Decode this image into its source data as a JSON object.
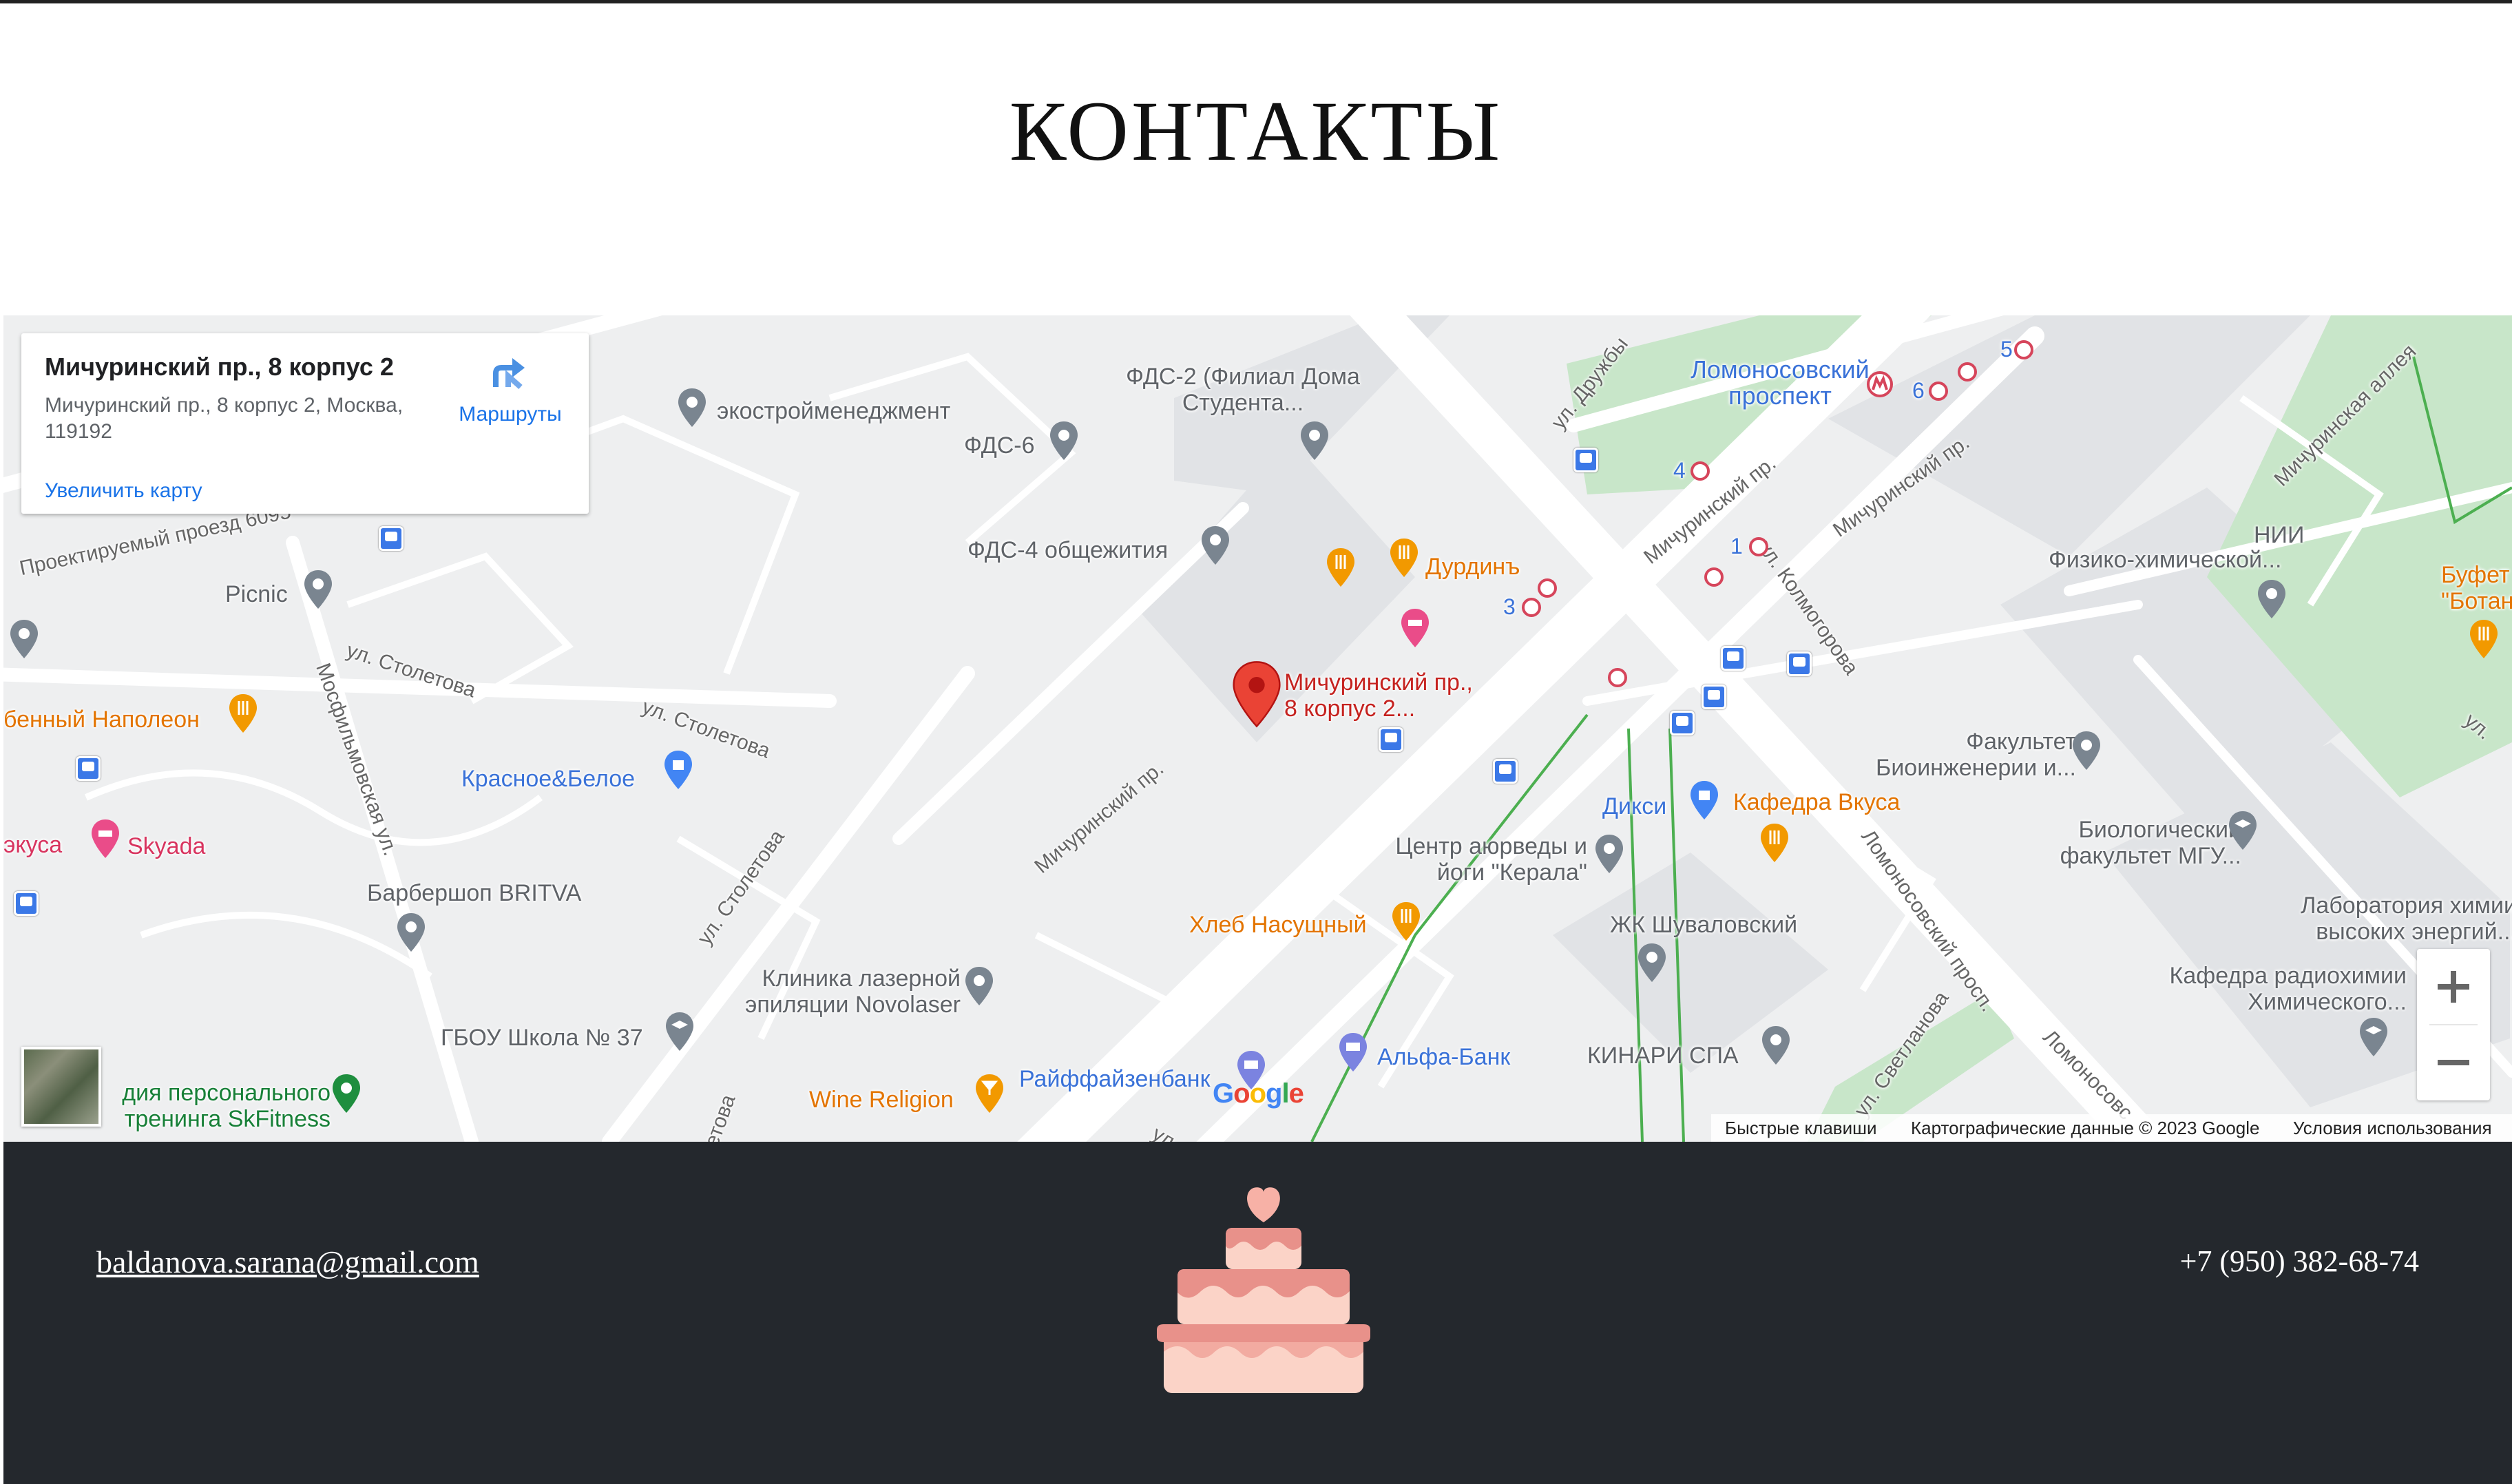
{
  "page": {
    "title": "КОНТАКТЫ"
  },
  "map": {
    "info_card": {
      "title": "Мичуринский пр., 8 корпус 2",
      "address": "Мичуринский пр., 8 корпус 2, Москва, 119192",
      "enlarge_label": "Увеличить карту",
      "directions_label": "Маршруты"
    },
    "labels": {
      "ecostroy": "экостройменеджмент",
      "fds2": "ФДС-2 (Филиал Дома Студента...",
      "fds6": "ФДС-6",
      "fds4": "ФДС-4 общежития",
      "durdin": "Дурдинъ",
      "marker": "Мичуринский пр., 8 корпус 2...",
      "lomonosov_metro": "Ломоносовский проспект",
      "fiziko": "Физико-химической...",
      "nii": "НИИ",
      "bufet": "Буфет \"Ботан",
      "fakultet_bio": "Факультет Биоинженерии и...",
      "biofak": "Биологический факультет МГУ...",
      "laboratory": "Лаборатория химии высоких энергий...",
      "kafedra_radio": "Кафедра радиохимии Химического...",
      "picnic": "Picnic",
      "napoleon": "бенный Наполеон",
      "krasnoe": "Красное&Белое",
      "skyada": "Skyada",
      "skyada_left": "экуса",
      "britva": "Барбершоп BRITVA",
      "dixi": "Дикси",
      "kafedra_vkusa": "Кафедра Вкуса",
      "ayurveda": "Центр аюрведы и йоги \"Керала\"",
      "hleb": "Хлеб Насущный",
      "zhk": "ЖК Шуваловский",
      "klinika": "Клиника лазерной эпиляции Novolaser",
      "gbou": "ГБОУ Школа № 37",
      "skfitness": "дия персонального тренинга SkFitness",
      "wine": "Wine Religion",
      "raiffeisen": "Райффайзенбанк",
      "alfa": "Альфа-Банк",
      "kinari": "КИНАРИ СПА",
      "road_proektir": "Проектируемый проезд 6095",
      "road_stoletova1": "ул. Столетова",
      "road_stoletova2": "ул. Столетова",
      "road_stoletova3": "ул. Столетова",
      "road_mosfilm": "Мосфильмовская ул.",
      "road_michurin1": "Мичуринский пр.",
      "road_michurin2": "Мичуринский пр.",
      "road_michurin3": "Мичуринский пр.",
      "road_druzhby": "ул. Дружбы",
      "road_kolmogorova": "ул. Колмогорова",
      "road_lomonos": "Ломоносовский просп.",
      "road_lomonos2": "Ломоносовс",
      "road_svetlanova": "ул. Светланова",
      "road_michurin_alley": "Мичуринская аллея",
      "road_ul_right": "ул.",
      "road_ul_bottom": "ул.",
      "road_etova": "етова",
      "metro_num_1": "1",
      "metro_num_3": "3",
      "metro_num_4": "4",
      "metro_num_5": "5",
      "metro_num_6": "6"
    },
    "google_logo": [
      "G",
      "o",
      "o",
      "g",
      "l",
      "e"
    ],
    "attribution": {
      "shortcuts": "Быстрые клавиши",
      "data": "Картографические данные © 2023 Google",
      "terms": "Условия использования"
    },
    "colors": {
      "background": "#eeeff0",
      "road": "#ffffff",
      "park": "#c8e6c9",
      "block": "#e1e3e6",
      "marker": "#ea4335"
    }
  },
  "footer": {
    "email": "baldanova.sarana@gmail.com",
    "phone": "+7 (950) 382-68-74",
    "logo_icon": "cake-icon",
    "background": "#24282d"
  }
}
